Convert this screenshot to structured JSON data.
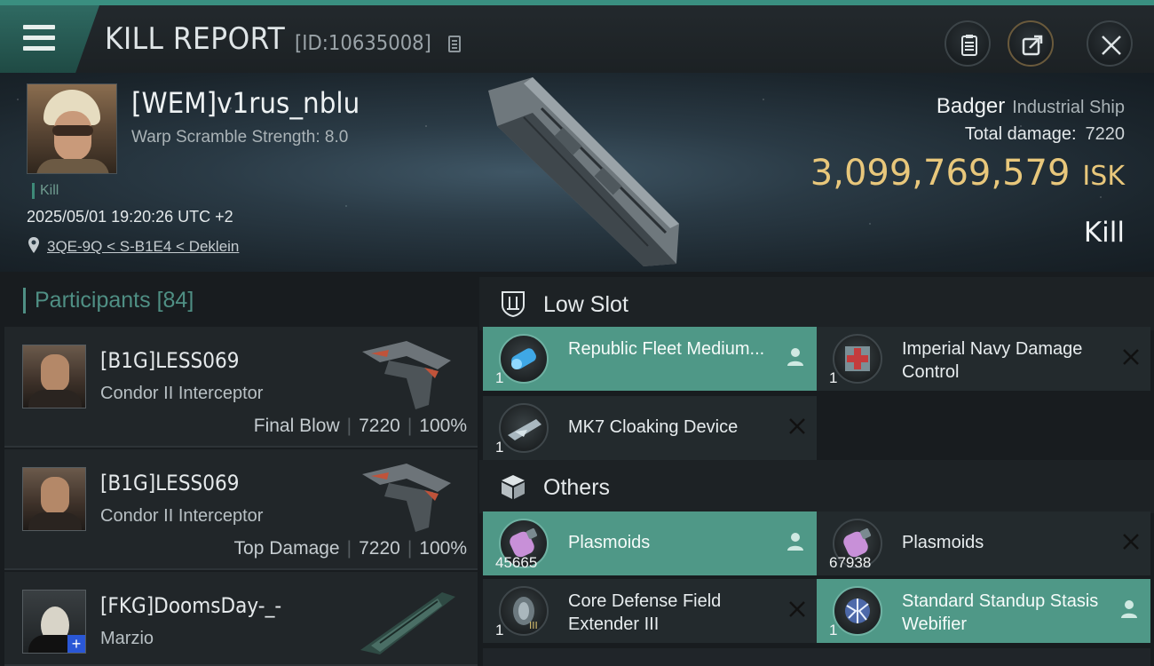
{
  "header": {
    "title": "KILL REPORT",
    "report_id": "[ID:10635008]",
    "colors": {
      "accent": "#3a8f80",
      "isk": "#e8c77b",
      "active_item": "#4f9887"
    }
  },
  "victim": {
    "name": "[WEM]v1rus_nblu",
    "warp_scramble": "Warp Scramble Strength: 8.0",
    "tag": "Kill",
    "datetime": "2025/05/01 19:20:26 UTC +2",
    "location": "3QE-9Q < S-B1E4 < Deklein",
    "ship": "Badger",
    "ship_class": "Industrial Ship",
    "total_damage_label": "Total damage:",
    "total_damage": "7220",
    "isk_value": "3,099,769,579",
    "isk_unit": "ISK",
    "result": "Kill"
  },
  "participants": {
    "label": "Participants",
    "count": "[84]",
    "list": [
      {
        "name": "[B1G]LESS069",
        "ship": "Condor II Interceptor",
        "role": "Final Blow",
        "damage": "7220",
        "percent": "100%"
      },
      {
        "name": "[B1G]LESS069",
        "ship": "Condor II Interceptor",
        "role": "Top Damage",
        "damage": "7220",
        "percent": "100%"
      },
      {
        "name": "[FKG]DoomsDay-_-",
        "ship": "Marzio"
      }
    ]
  },
  "slots": {
    "low_slot": {
      "label": "Low Slot",
      "items": [
        {
          "name": "Republic Fleet Medium...",
          "qty": "1",
          "state": "active",
          "icon": "armor-plate-icon"
        },
        {
          "name": "Imperial Navy Damage Control",
          "qty": "1",
          "state": "destroyed",
          "icon": "damage-control-icon"
        },
        {
          "name": "MK7 Cloaking Device",
          "qty": "1",
          "state": "destroyed",
          "icon": "cloak-icon"
        }
      ]
    },
    "others": {
      "label": "Others",
      "items": [
        {
          "name": "Plasmoids",
          "qty": "45665",
          "state": "active",
          "icon": "plasmoid-icon"
        },
        {
          "name": "Plasmoids",
          "qty": "67938",
          "state": "destroyed",
          "icon": "plasmoid-icon"
        },
        {
          "name": "Core Defense Field Extender III",
          "qty": "1",
          "state": "destroyed",
          "icon": "shield-extender-icon"
        },
        {
          "name": "Standard Standup Stasis Webifier",
          "qty": "1",
          "state": "active",
          "icon": "webifier-icon"
        }
      ]
    }
  }
}
